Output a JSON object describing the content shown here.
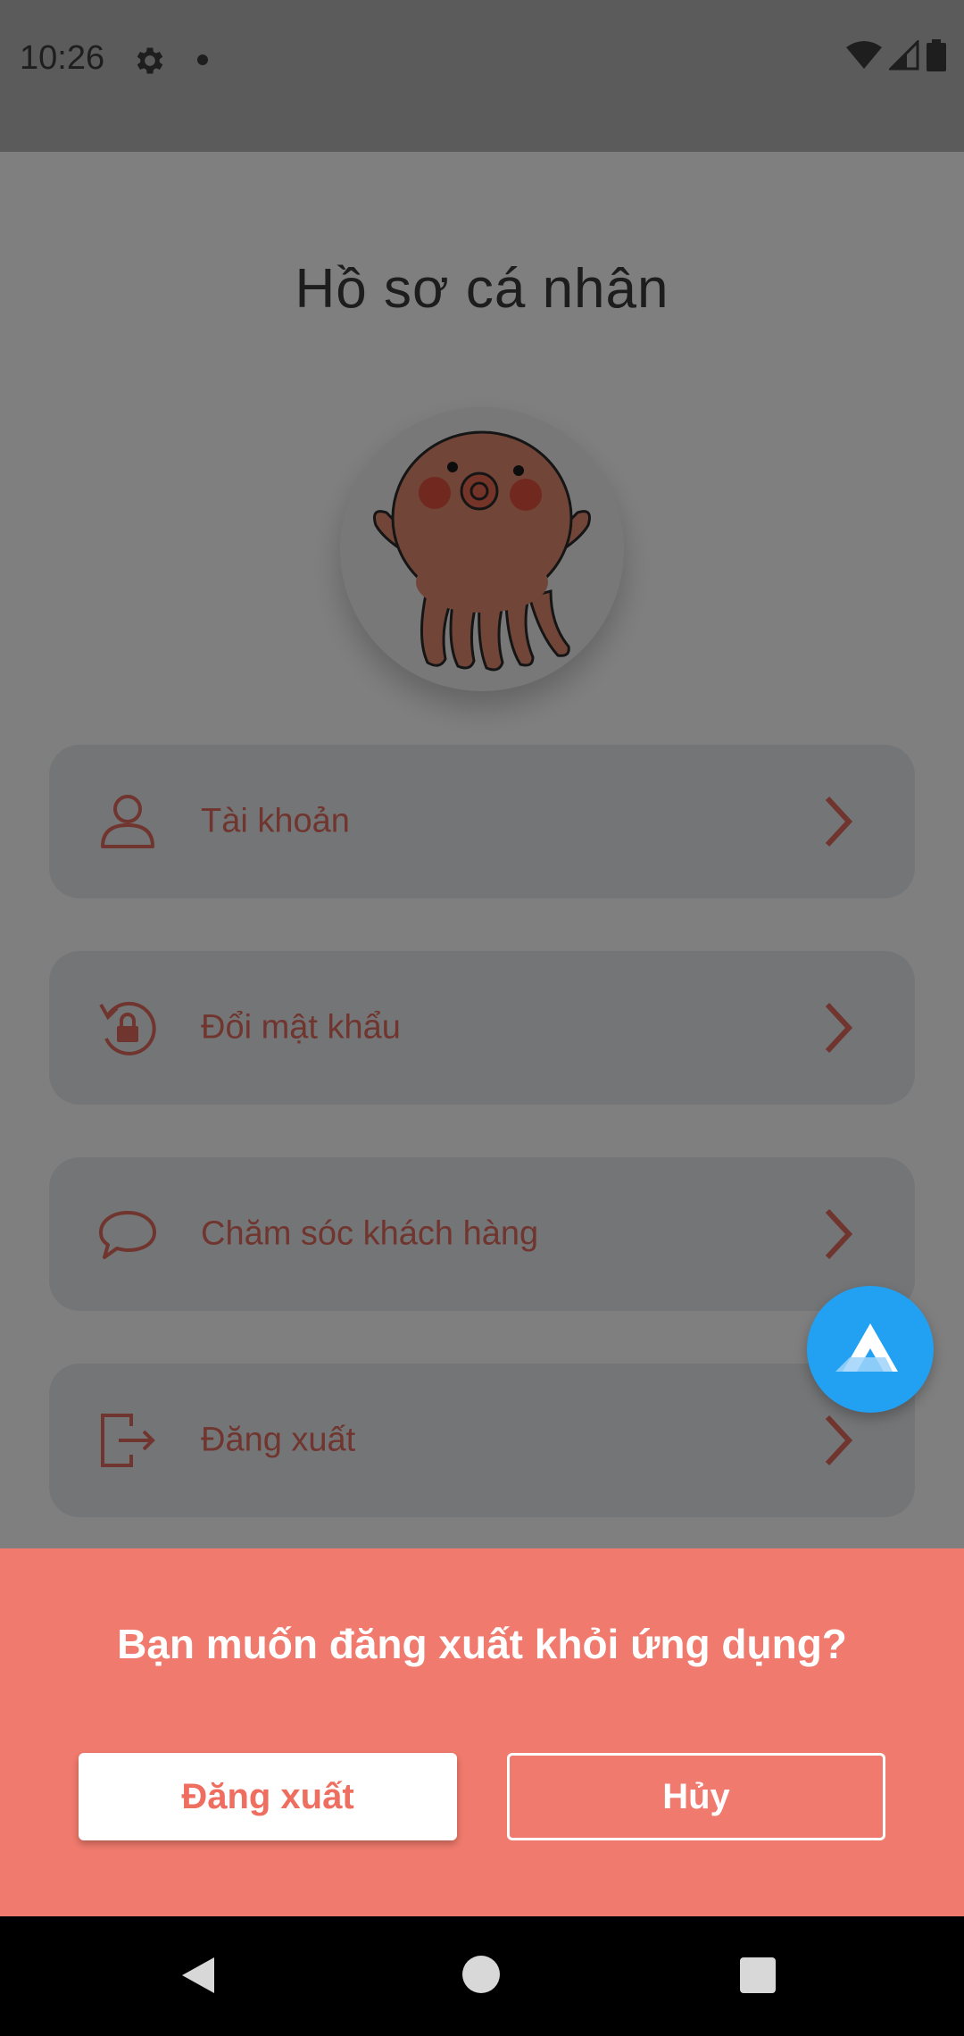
{
  "status_bar": {
    "time": "10:26",
    "icons": [
      "gear-icon",
      "notification-dot-icon",
      "wifi-icon",
      "signal-icon",
      "battery-icon"
    ]
  },
  "page": {
    "title": "Hồ sơ cá nhân",
    "avatar_icon": "octopus-avatar",
    "menu": [
      {
        "label": "Tài khoản",
        "icon": "user-icon"
      },
      {
        "label": "Đổi mật khẩu",
        "icon": "lock-refresh-icon"
      },
      {
        "label": "Chăm sóc khách hàng",
        "icon": "chat-bubble-icon"
      },
      {
        "label": "Đăng xuất",
        "icon": "logout-icon"
      }
    ]
  },
  "floating_button": {
    "icon": "assistant-a-icon"
  },
  "dialog": {
    "question": "Bạn muốn đăng xuất khỏi ứng dụng?",
    "confirm_label": "Đăng xuất",
    "cancel_label": "Hủy"
  },
  "colors": {
    "accent": "#E06A5C",
    "sheet": "#F07A6D",
    "fab": "#22A0F2"
  },
  "nav_bar": {
    "icons": [
      "back-icon",
      "home-icon",
      "recents-icon"
    ]
  }
}
